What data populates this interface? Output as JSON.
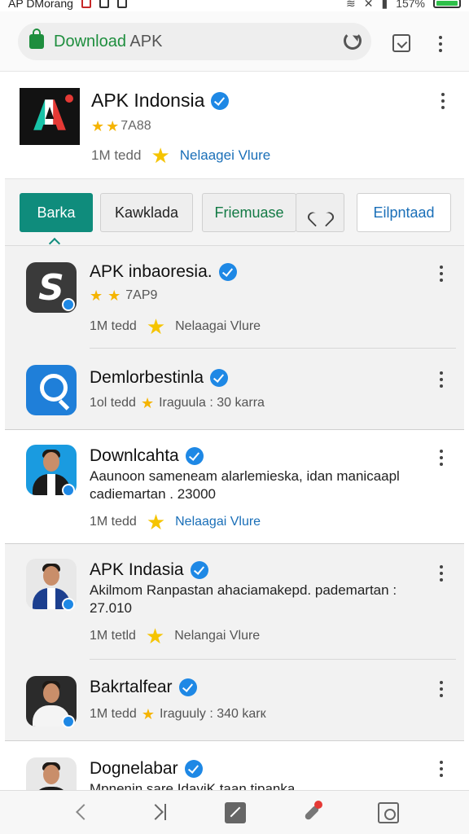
{
  "status_bar": {
    "carrier": "AP DMorang",
    "battery": "157%"
  },
  "browser": {
    "url_prefix": "Download",
    "url_suffix": " APK"
  },
  "app_header": {
    "title": "APK Indonsia",
    "rating": "7A88",
    "installs": "1M tedd",
    "link": "Nelaagei Vlure"
  },
  "tabs": [
    "Barka",
    "Kawklada",
    "Friemuase",
    "Eilpntaad"
  ],
  "apps": [
    {
      "title": "APK inbaoresia.",
      "rating": "7AP9",
      "installs": "1M tedd",
      "link": "Nelaagai Vlure"
    },
    {
      "title": "Demlorbestinla",
      "installs": "1ol tedd",
      "meta": "Iraguula : 30 karra"
    },
    {
      "title": "Downlcahta",
      "desc": "Aaunoon sameneam alarlemieska, idan manicaapl cadiemartan . 23000",
      "installs": "1M tedd",
      "link": "Nelaagai Vlure"
    },
    {
      "title": "APK Indasia",
      "desc": "Akilmom Ranpastan ahaciamakepd. pademartan : 27.010",
      "installs": "1M tetld",
      "link": "Nelangai Vlure"
    },
    {
      "title": "Bakrtalfear",
      "installs": "1M tedd",
      "meta": "Iraguuly : 340 karк"
    },
    {
      "title": "Dognelabar",
      "desc": "Mpnenin sare IdaviK taan tipanka"
    }
  ],
  "colors": {
    "accent": "#0f8c7c",
    "link": "#1a6fb8",
    "verified": "#1e88e5",
    "secure": "#1e8e3e",
    "star": "#f5b400"
  }
}
